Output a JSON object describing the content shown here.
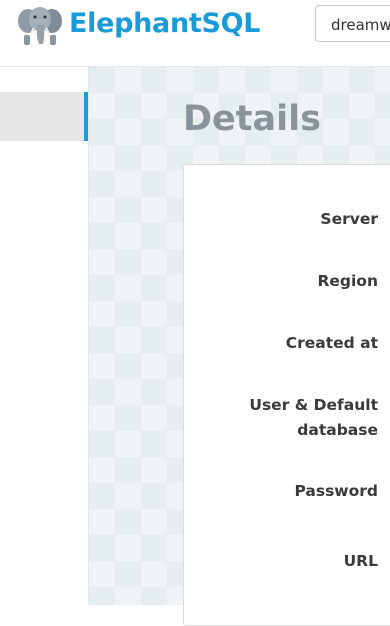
{
  "header": {
    "brand": "ElephantSQL",
    "logo_icon": "elephant-icon",
    "instance_select_value": "dreamw"
  },
  "main": {
    "title": "Details",
    "fields": [
      {
        "label": "Server"
      },
      {
        "label": "Region"
      },
      {
        "label": "Created at"
      },
      {
        "label_line1": "User & Default",
        "label_line2": "database"
      },
      {
        "label": "Password"
      },
      {
        "label": "URL"
      }
    ]
  },
  "colors": {
    "brand": "#1a9bd7",
    "title": "#8a9399",
    "label": "#3a3a3a",
    "background": "#e6edef"
  }
}
